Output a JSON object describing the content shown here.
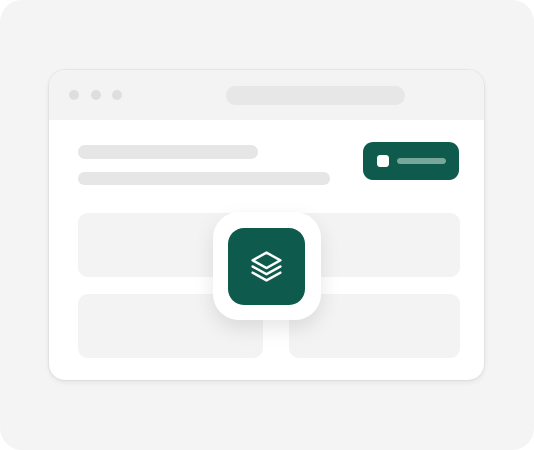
{
  "theme": {
    "accent": "#0e5a4c",
    "background": "#f4f4f4",
    "skeleton": "#e6e6e6"
  },
  "window": {
    "controls": [
      "dot",
      "dot",
      "dot"
    ]
  },
  "header": {
    "action_button_icon": "square-icon"
  },
  "app_icon": {
    "name": "layers-icon"
  }
}
